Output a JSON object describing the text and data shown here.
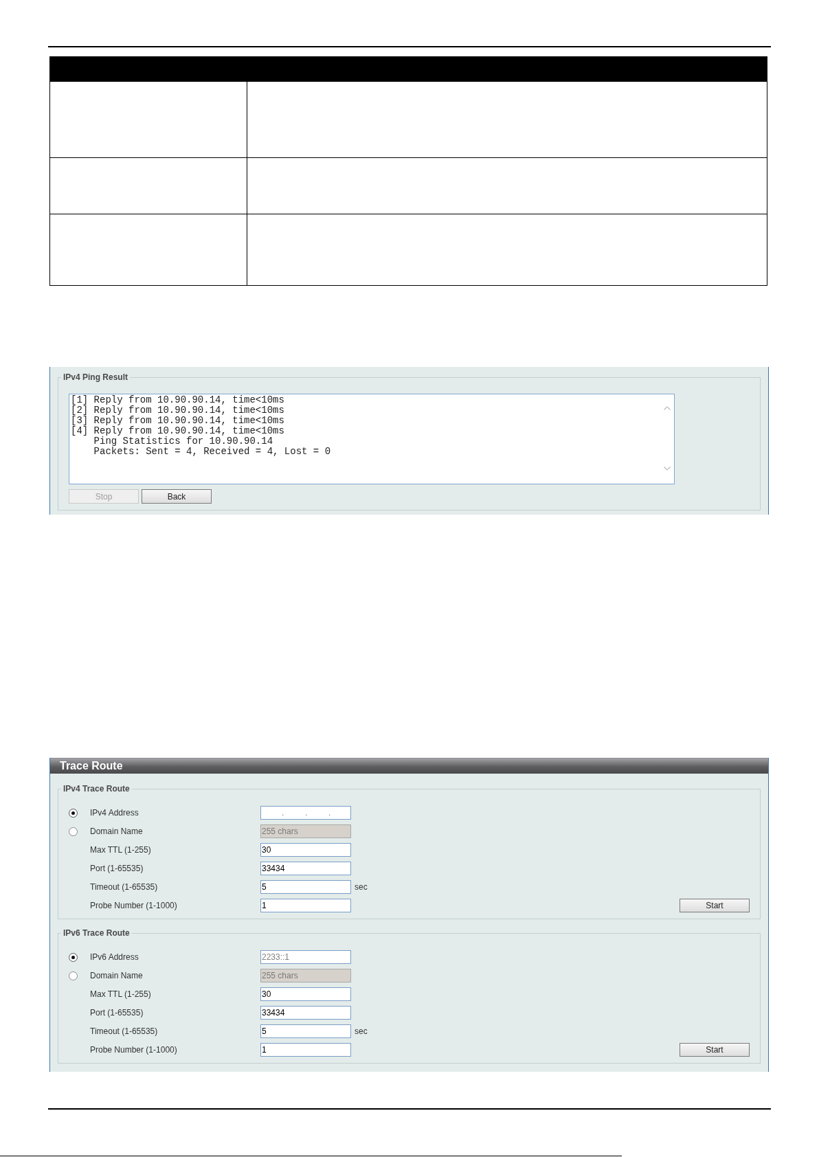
{
  "ping_result": {
    "title": "IPv4 Ping Result",
    "output_lines": [
      {
        "kind": "reply",
        "text": "[1] Reply from 10.90.90.14, time<10ms"
      },
      {
        "kind": "reply",
        "text": "[2] Reply from 10.90.90.14, time<10ms"
      },
      {
        "kind": "reply",
        "text": "[3] Reply from 10.90.90.14, time<10ms"
      },
      {
        "kind": "reply",
        "text": "[4] Reply from 10.90.90.14, time<10ms"
      },
      {
        "kind": "summary",
        "text": "Ping Statistics for 10.90.90.14"
      },
      {
        "kind": "summary",
        "text": "Packets: Sent = 4, Received = 4, Lost = 0"
      }
    ],
    "buttons": [
      {
        "label": "Stop",
        "disabled": true
      },
      {
        "label": "Back",
        "disabled": false
      }
    ]
  },
  "trace_route": {
    "title": "Trace Route",
    "sections": [
      {
        "title": "IPv4 Trace Route",
        "targets": [
          {
            "label": "IPv4 Address",
            "selected": true,
            "input": {
              "kind": "ipv4",
              "separators": [
                ".",
                ".",
                "."
              ],
              "disabled": false
            }
          },
          {
            "label": "Domain Name",
            "selected": false,
            "input": {
              "kind": "text",
              "placeholder": "255 chars",
              "disabled": true
            }
          }
        ],
        "params": [
          {
            "label": "Max TTL (1-255)",
            "value": "30"
          },
          {
            "label": "Port (1-65535)",
            "value": "33434"
          },
          {
            "label": "Timeout (1-65535)",
            "value": "5",
            "unit": "sec"
          },
          {
            "label": "Probe Number (1-1000)",
            "value": "1"
          }
        ],
        "button": "Start"
      },
      {
        "title": "IPv6 Trace Route",
        "targets": [
          {
            "label": "IPv6 Address",
            "selected": true,
            "input": {
              "kind": "text",
              "placeholder": "2233::1",
              "disabled": false
            }
          },
          {
            "label": "Domain Name",
            "selected": false,
            "input": {
              "kind": "text",
              "placeholder": "255 chars",
              "disabled": true
            }
          }
        ],
        "params": [
          {
            "label": "Max TTL (1-255)",
            "value": "30"
          },
          {
            "label": "Port (1-65535)",
            "value": "33434"
          },
          {
            "label": "Timeout (1-65535)",
            "value": "5",
            "unit": "sec"
          },
          {
            "label": "Probe Number (1-1000)",
            "value": "1"
          }
        ],
        "button": "Start"
      }
    ]
  }
}
